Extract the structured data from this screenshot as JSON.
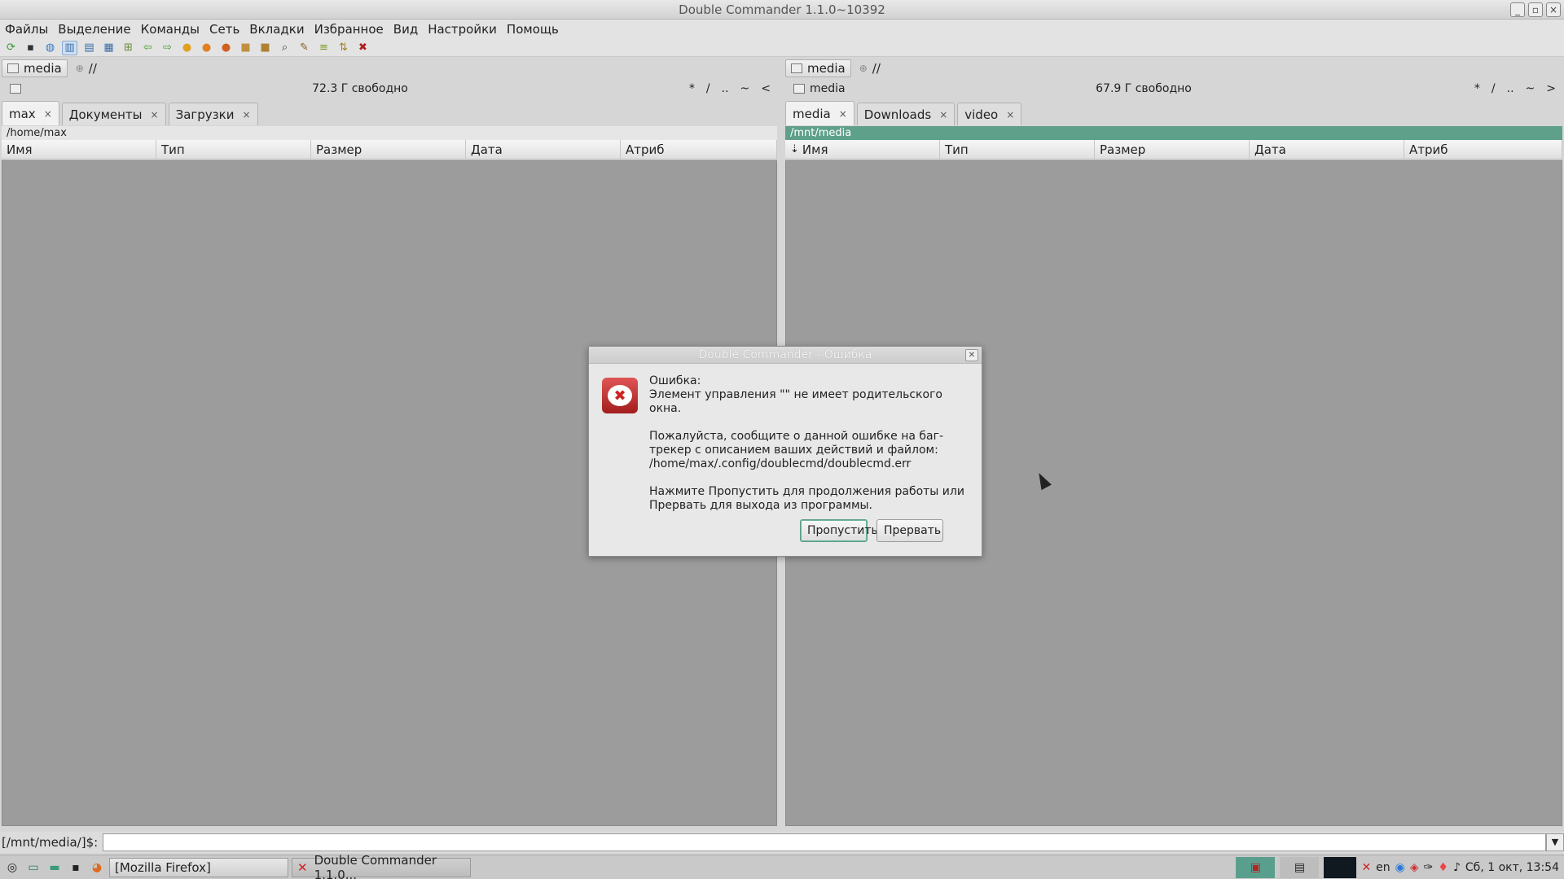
{
  "window": {
    "title": "Double Commander 1.1.0~10392",
    "controls": [
      "_",
      "▫",
      "×"
    ]
  },
  "menu": [
    "Файлы",
    "Выделение",
    "Команды",
    "Сеть",
    "Вкладки",
    "Избранное",
    "Вид",
    "Настройки",
    "Помощь"
  ],
  "toolbar": [
    "refresh-icon",
    "terminal-icon",
    "network-icon",
    "brief-view-icon",
    "columns-view-icon",
    "thumbnails-view-icon",
    "flat-view-icon",
    "back-icon",
    "forward-icon",
    "copy-icon",
    "move-icon",
    "delete-icon",
    "pack-icon",
    "unpack-icon",
    "search-icon",
    "multi-rename-icon",
    "compare-icon",
    "sync-icon",
    "exit-icon"
  ],
  "left_panel": {
    "drive": "media",
    "net_label": "//",
    "free_space": "72.3 Г свободно",
    "nav": [
      "*",
      "/",
      "..",
      "~",
      "<"
    ],
    "tabs": [
      {
        "label": "max",
        "close": "×"
      },
      {
        "label": "Документы",
        "close": "×"
      },
      {
        "label": "Загрузки",
        "close": "×"
      }
    ],
    "path": "/home/max",
    "columns": [
      "Имя",
      "Тип",
      "Размер",
      "Дата",
      "Атриб"
    ]
  },
  "right_panel": {
    "drive": "media",
    "net_label": "//",
    "drive_label": "media",
    "free_space": "67.9 Г свободно",
    "nav": [
      "*",
      "/",
      "..",
      "~",
      ">"
    ],
    "tabs": [
      {
        "label": "media",
        "close": "×"
      },
      {
        "label": "Downloads",
        "close": "×"
      },
      {
        "label": "video",
        "close": "×"
      }
    ],
    "path": "/mnt/media",
    "columns": [
      "Имя",
      "Тип",
      "Размер",
      "Дата",
      "Атриб"
    ]
  },
  "cmdline": {
    "prompt": "[/mnt/media/]$:",
    "value": ""
  },
  "dialog": {
    "title": "Double Commander - Ошибка",
    "message": "Ошибка:\nЭлемент управления \"\" не имеет родительского окна.\n\nПожалуйста, сообщите о данной ошибке на баг-трекер с описанием ваших действий и файлом:\n/home/max/.config/doublecmd/doublecmd.err\n\nНажмите Пропустить для продолжения работы или Прервать для выхода из программы.",
    "skip_label": "Пропустить",
    "abort_label": "Прервать"
  },
  "taskbar": {
    "firefox_task": "[Mozilla Firefox]",
    "doublecmd_task": "Double Commander 1.1.0...",
    "lang": "en",
    "clock": "Сб, 1 окт, 13:54"
  },
  "colors": {
    "accent": "#5fa08b",
    "panel_bg": "#9c9c9c",
    "error_red": "#c22222"
  }
}
